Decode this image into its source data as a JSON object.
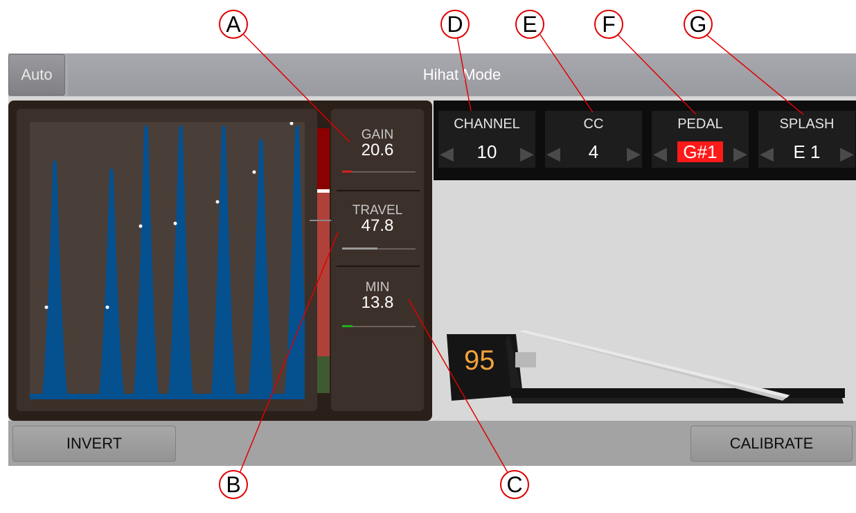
{
  "header": {
    "auto_label": "Auto",
    "mode_title": "Hihat Mode"
  },
  "knobs": [
    {
      "label": "GAIN",
      "value": "20.6",
      "level": 0.13,
      "color": "#d42020"
    },
    {
      "label": "TRAVEL",
      "value": "47.8",
      "level": 0.48,
      "color": "#9a9a9a"
    },
    {
      "label": "MIN",
      "value": "13.8",
      "level": 0.14,
      "color": "#20b020"
    }
  ],
  "params": [
    {
      "label": "CHANNEL",
      "value": "10",
      "highlighted": false
    },
    {
      "label": "CC",
      "value": "4",
      "highlighted": false
    },
    {
      "label": "PEDAL",
      "value": "G#1",
      "highlighted": true
    },
    {
      "label": "SPLASH",
      "value": "E 1",
      "highlighted": false
    }
  ],
  "pedal": {
    "position_value": "95"
  },
  "buttons": {
    "invert": "INVERT",
    "calibrate": "CALIBRATE"
  },
  "callouts": [
    "A",
    "B",
    "C",
    "D",
    "E",
    "F",
    "G"
  ],
  "graph": {
    "peak_heights": [
      0.87,
      0.84,
      1.0,
      1.0,
      1.0,
      0.95,
      1.0
    ],
    "dot_levels": [
      0.32,
      0.32,
      0.62,
      0.63,
      0.71,
      0.82,
      1.0
    ],
    "fill_color": "#05508f",
    "dot_color": "#ffffff"
  },
  "meter": {
    "colors": [
      "#8b0000",
      "#ffffff",
      "#b0413a",
      "#3f5a30"
    ]
  },
  "icons": [
    "arrow-left-icon",
    "arrow-right-icon"
  ]
}
